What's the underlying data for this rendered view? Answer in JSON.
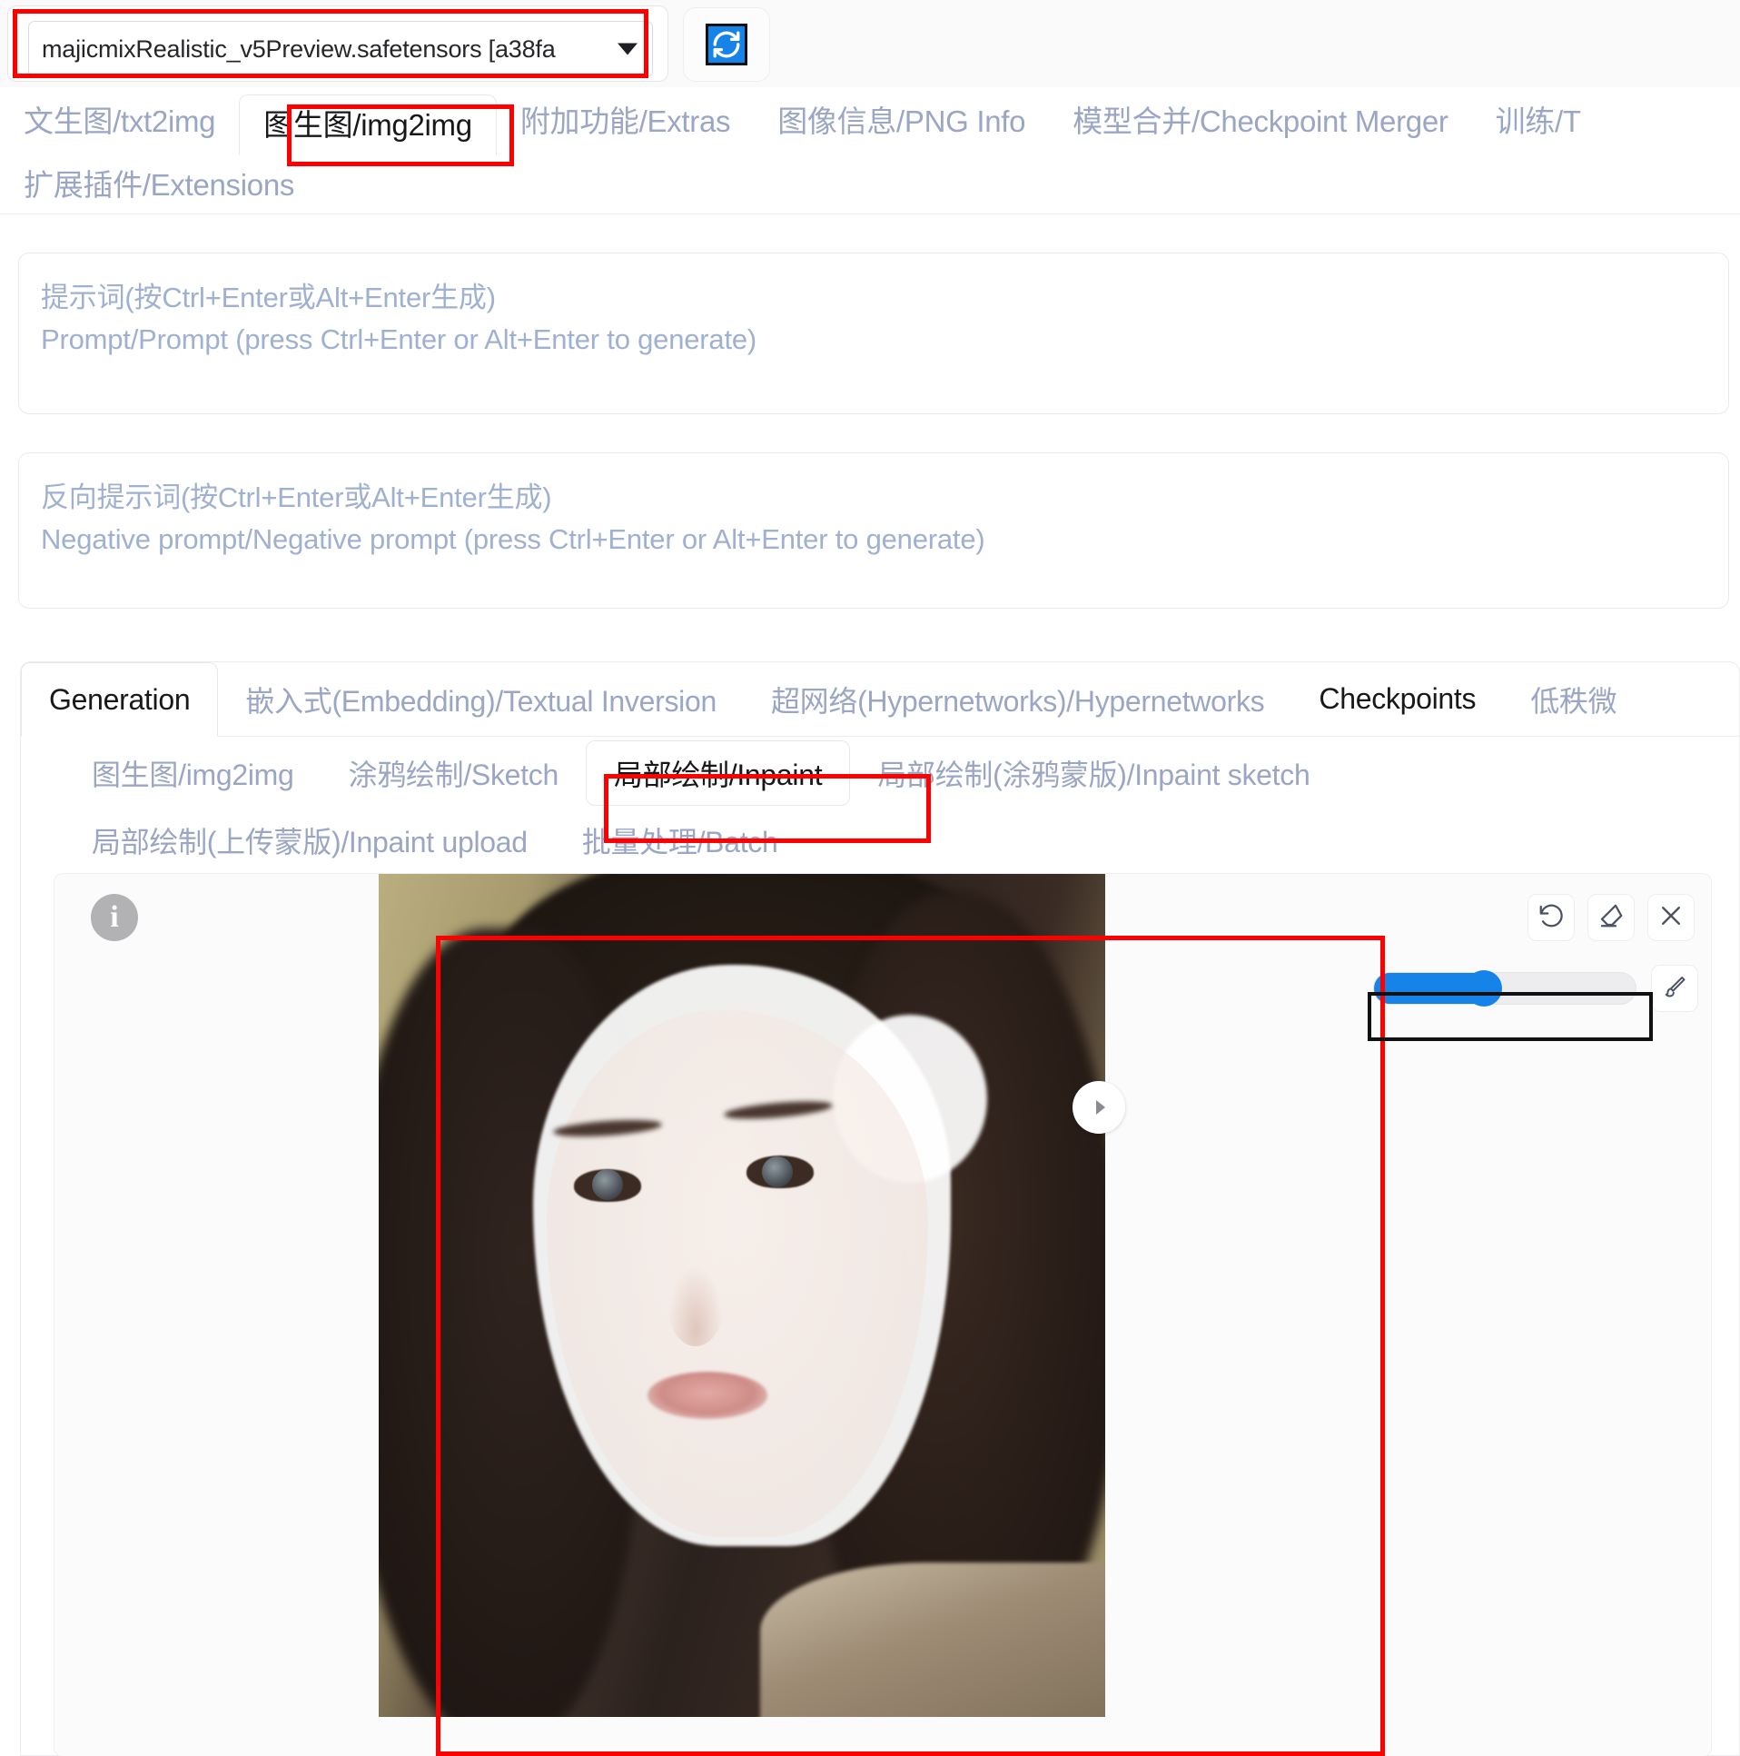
{
  "topbar": {
    "model_selector": {
      "value": "majicmixRealistic_v5Preview.safetensors [a38fa",
      "icon": "chevron-down-icon"
    },
    "refresh_button": {
      "icon": "refresh-icon",
      "label": ""
    }
  },
  "main_tabs": {
    "row1": [
      {
        "label": "文生图/txt2img",
        "active": false
      },
      {
        "label": "图生图/img2img",
        "active": true,
        "highlighted": true
      },
      {
        "label": "附加功能/Extras",
        "active": false
      },
      {
        "label": "图像信息/PNG Info",
        "active": false
      },
      {
        "label": "模型合并/Checkpoint Merger",
        "active": false
      },
      {
        "label": "训练/T",
        "active": false
      }
    ],
    "row2": [
      {
        "label": "扩展插件/Extensions",
        "active": false
      }
    ]
  },
  "prompt": {
    "placeholder_cn": "提示词(按Ctrl+Enter或Alt+Enter生成)",
    "placeholder_en": "Prompt/Prompt (press Ctrl+Enter or Alt+Enter to generate)",
    "value": ""
  },
  "negative_prompt": {
    "placeholder_cn": "反向提示词(按Ctrl+Enter或Alt+Enter生成)",
    "placeholder_en": "Negative prompt/Negative prompt (press Ctrl+Enter or Alt+Enter to generate)",
    "value": ""
  },
  "generation_tabs": [
    {
      "label": "Generation",
      "active": true
    },
    {
      "label": "嵌入式(Embedding)/Textual Inversion",
      "active": false
    },
    {
      "label": "超网络(Hypernetworks)/Hypernetworks",
      "active": false
    },
    {
      "label": "Checkpoints",
      "active": false
    },
    {
      "label": "低秩微",
      "active": false
    }
  ],
  "sub_tabs": {
    "row1": [
      {
        "label": "图生图/img2img",
        "active": false
      },
      {
        "label": "涂鸦绘制/Sketch",
        "active": false
      },
      {
        "label": "局部绘制/Inpaint",
        "active": true,
        "highlighted": true
      },
      {
        "label": "局部绘制(涂鸦蒙版)/Inpaint sketch",
        "active": false
      }
    ],
    "row2": [
      {
        "label": "局部绘制(上传蒙版)/Inpaint upload",
        "active": false
      },
      {
        "label": "批量处理/Batch",
        "active": false
      }
    ]
  },
  "editor": {
    "info_icon": "info-icon",
    "info_label": "i",
    "tools": [
      {
        "name": "undo-icon",
        "label": ""
      },
      {
        "name": "eraser-icon",
        "label": ""
      },
      {
        "name": "close-icon",
        "label": ""
      }
    ],
    "brush_slider": {
      "name": "brush-size-slider",
      "value_percent": 42
    },
    "brush_button": {
      "name": "brush-icon",
      "label": ""
    },
    "nav_next": {
      "name": "chevron-right-icon",
      "label": ""
    }
  },
  "colors": {
    "accent_blue": "#1583e8",
    "highlight_red": "#ff0000",
    "tab_inactive": "#9aa6c4",
    "tab_active": "#18181b",
    "placeholder": "#9fb0d0"
  }
}
